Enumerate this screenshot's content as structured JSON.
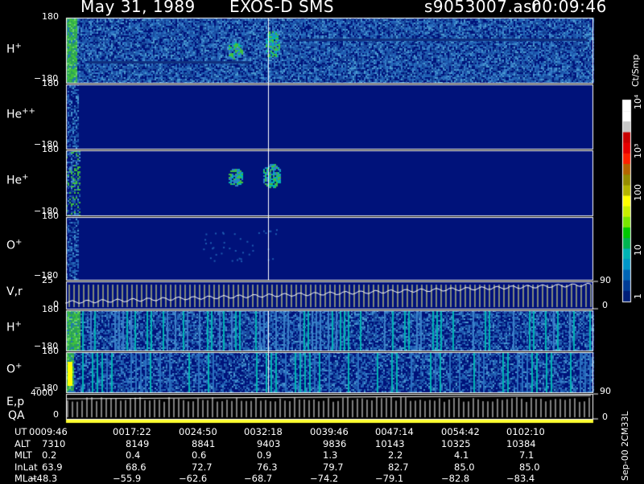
{
  "header": {
    "date": "May 31, 1989",
    "instrument": "EXOS-D SMS",
    "file": "s9053007.asr",
    "time": "00:09:46"
  },
  "panels": [
    {
      "label": "H",
      "sup": "+",
      "top": "180",
      "bottom": "−180"
    },
    {
      "label": "He",
      "sup": "++",
      "top": "180",
      "bottom": "−180"
    },
    {
      "label": "He",
      "sup": "+",
      "top": "180",
      "bottom": "−180"
    },
    {
      "label": "O",
      "sup": "+",
      "top": "180",
      "bottom": "−180"
    },
    {
      "label": "V,r",
      "sup": "",
      "top": "25",
      "bottom": "0"
    },
    {
      "label": "H",
      "sup": "+",
      "top": "180",
      "bottom": "−180"
    },
    {
      "label": "O",
      "sup": "+",
      "top": "180",
      "bottom": "−180"
    },
    {
      "label": "E,p",
      "sup": "",
      "top": "4000",
      "bottom": "0"
    }
  ],
  "qa_label": "QA",
  "right_axis": {
    "vr_top": "90",
    "vr_bottom": "0",
    "ep_top": "90",
    "ep_bottom": "0"
  },
  "colorbar": {
    "unit": "Ct/Smp",
    "labels": [
      "10⁴",
      "10³",
      "100",
      "10",
      "1"
    ],
    "colors": [
      "#ffffff",
      "#ffffff",
      "#c8c8c8",
      "#c80000",
      "#e60000",
      "#ff2000",
      "#b46400",
      "#968c00",
      "#b4b400",
      "#ffff00",
      "#c8f000",
      "#78e600",
      "#00c800",
      "#00b450",
      "#00b4b4",
      "#0096c8",
      "#0064b4",
      "#003c96",
      "#001e78"
    ]
  },
  "footer_label": "Sep-00 2CM33L",
  "ut_table": {
    "rows": [
      {
        "name": "UT",
        "values": [
          "0009:46",
          "0017:22",
          "0024:50",
          "0032:18",
          "0039:46",
          "0047:14",
          "0054:42",
          "0102:10"
        ]
      },
      {
        "name": "ALT",
        "values": [
          "7310",
          "8149",
          "8841",
          "9403",
          "9836",
          "10143",
          "10325",
          "10384"
        ]
      },
      {
        "name": "MLT",
        "values": [
          "0.2",
          "0.4",
          "0.6",
          "0.9",
          "1.3",
          "2.2",
          "4.1",
          "7.1"
        ]
      },
      {
        "name": "InLat",
        "values": [
          "63.9",
          "68.6",
          "72.7",
          "76.3",
          "79.7",
          "82.7",
          "85.0",
          "85.0"
        ]
      },
      {
        "name": "MLat",
        "values": [
          "−48.3",
          "−55.9",
          "−62.6",
          "−68.7",
          "−74.2",
          "−79.1",
          "−82.8",
          "−83.4"
        ]
      }
    ]
  },
  "chart_data": {
    "type": "heatmap",
    "title": "May 31, 1989   EXOS-D SMS",
    "x_ticks": [
      "0009:46",
      "0017:22",
      "0024:50",
      "0032:18",
      "0039:46",
      "0047:14",
      "0054:42",
      "0102:10"
    ],
    "colorscale_unit": "Ct/Smp",
    "colorscale_range": [
      1,
      10000
    ],
    "colorscale_log": true,
    "panels": [
      {
        "species": "H+",
        "ylim": [
          -180,
          180
        ]
      },
      {
        "species": "He++",
        "ylim": [
          -180,
          180
        ]
      },
      {
        "species": "He+",
        "ylim": [
          -180,
          180
        ]
      },
      {
        "species": "O+",
        "ylim": [
          -180,
          180
        ]
      },
      {
        "species": "V,r",
        "ylim": [
          0,
          25
        ],
        "right_ylim": [
          0,
          90
        ]
      },
      {
        "species": "H+",
        "ylim": [
          -180,
          180
        ]
      },
      {
        "species": "O+",
        "ylim": [
          -180,
          180
        ]
      },
      {
        "species": "E,p",
        "ylim": [
          0,
          4000
        ],
        "right_ylim": [
          0,
          90
        ]
      }
    ]
  }
}
